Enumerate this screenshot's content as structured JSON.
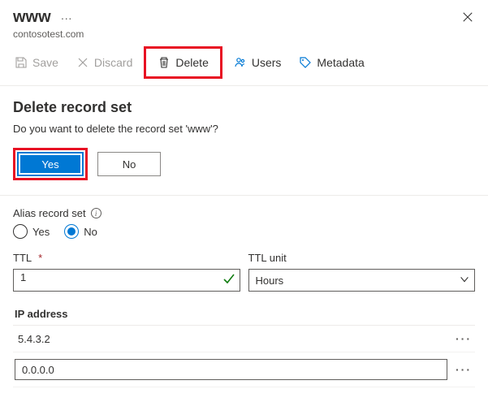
{
  "header": {
    "title": "www",
    "subtitle": "contosotest.com"
  },
  "toolbar": {
    "save": "Save",
    "discard": "Discard",
    "delete": "Delete",
    "users": "Users",
    "metadata": "Metadata"
  },
  "confirm": {
    "heading": "Delete record set",
    "question": "Do you want to delete the record set 'www'?",
    "yes": "Yes",
    "no": "No"
  },
  "alias": {
    "label": "Alias record set",
    "yes": "Yes",
    "no": "No",
    "selected": "No"
  },
  "ttl": {
    "label": "TTL",
    "value": "1",
    "unit_label": "TTL unit",
    "unit_value": "Hours"
  },
  "ip": {
    "header": "IP address",
    "rows": [
      "5.4.3.2"
    ],
    "new_value": "0.0.0.0"
  }
}
